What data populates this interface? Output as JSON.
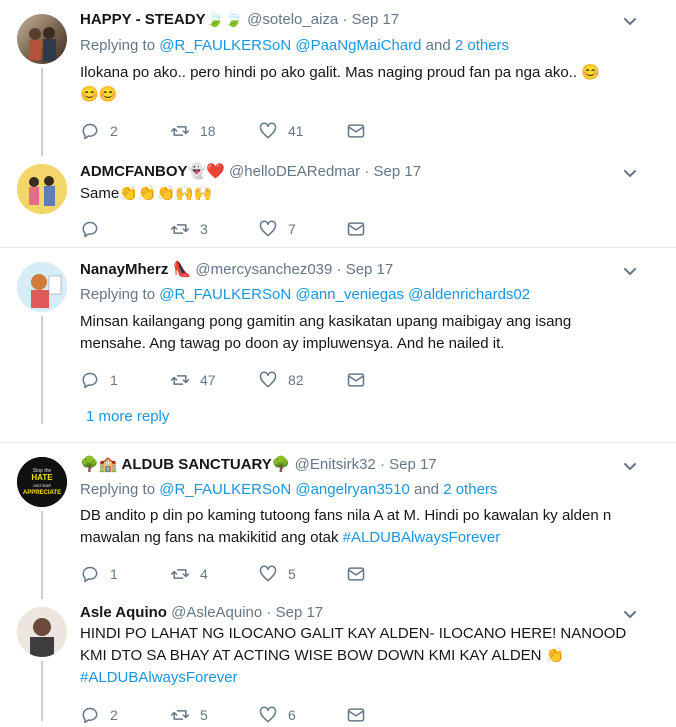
{
  "tweets": [
    {
      "name": "HAPPY - STEADY",
      "name_emojis": "🍃🍃",
      "handle": "@sotelo_aiza",
      "dot": "·",
      "date": "Sep 17",
      "replying_prefix": "Replying to",
      "reply_user1": "@R_FAULKERSoN",
      "reply_user2": "@PaaNgMaiChard",
      "reply_and": "and",
      "reply_others": "2 others",
      "text": "Ilokana po ako.. pero hindi  po ako galit. Mas naging proud fan pa nga ako..",
      "text_emojis_inline": "😊",
      "text_emojis_line2": "😊😊",
      "replies": "2",
      "retweets": "18",
      "likes": "41"
    },
    {
      "name": "ADMCFANBOY",
      "name_emojis": "👻❤️",
      "handle": "@helloDEARedmar",
      "dot": "·",
      "date": "Sep 17",
      "text": "Same",
      "text_emojis": "👏👏👏🙌🙌",
      "replies": "",
      "retweets": "3",
      "likes": "7"
    },
    {
      "name": "NanayMherz",
      "name_emojis": "👠",
      "handle": "@mercysanchez039",
      "dot": "·",
      "date": "Sep 17",
      "replying_prefix": "Replying to",
      "reply_user1": "@R_FAULKERSoN",
      "reply_user2": "@ann_veniegas",
      "reply_user3": "@aldenrichards02",
      "text_line1": "Minsan kailangang pong gamitin ang kasikatan upang maibigay ang isang",
      "text_line2": "mensahe. Ang tawag po doon ay impluwensya. And he nailed it.",
      "replies": "1",
      "retweets": "47",
      "likes": "82",
      "more_reply": "1 more reply"
    },
    {
      "name_prefix_emojis": "🌳🏫",
      "name": "ALDUB SANCTUARY",
      "name_emojis": "🌳",
      "handle": "@Enitsirk32",
      "dot": "·",
      "date": "Sep 17",
      "replying_prefix": "Replying to",
      "reply_user1": "@R_FAULKERSoN",
      "reply_user2": "@angelryan3510",
      "reply_and": "and",
      "reply_others": "2 others",
      "text_line1": "DB andito p din po kaming tutoong fans nila A at M. Hindi po kawalan ky alden n",
      "text_line2": "mawalan ng fans na makikitid ang otak",
      "hashtag": "#ALDUBAlwaysForever",
      "replies": "1",
      "retweets": "4",
      "likes": "5",
      "avatar_text": [
        "Stop the",
        "HATE",
        "and start",
        "APPRECIATE"
      ]
    },
    {
      "name": "Asle Aquino",
      "handle": "@AsleAquino",
      "dot": "·",
      "date": "Sep 17",
      "text_line1": "HINDI PO LAHAT NG ILOCANO GALIT KAY ALDEN- ILOCANO HERE! NANOOD",
      "text_line2": "KMI DTO SA BHAY AT ACTING WISE BOW DOWN KMI KAY ALDEN",
      "text_emoji": "👏",
      "hashtag": "#ALDUBAlwaysForever",
      "replies": "2",
      "retweets": "5",
      "likes": "6"
    }
  ],
  "colors": {
    "link": "#1b95e0",
    "secondary_text": "#657786",
    "primary_text": "#14171a",
    "separator": "#e6ecf0",
    "thread_line": "#c4cfd6"
  }
}
